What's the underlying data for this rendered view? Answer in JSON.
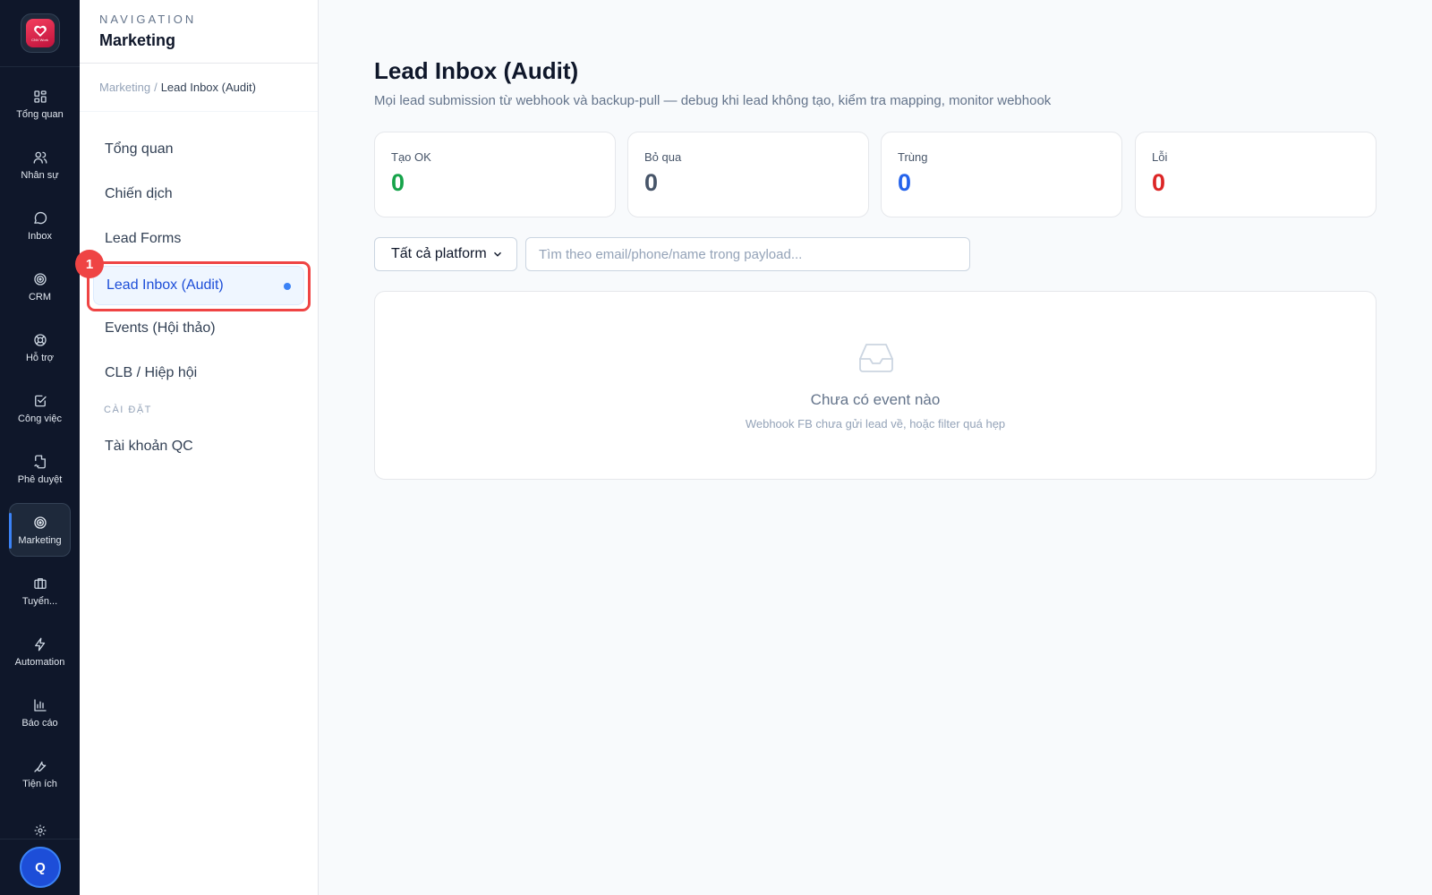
{
  "rail": {
    "logo_text": "CNV Work",
    "items": [
      {
        "label": "Tổng quan",
        "icon": "grid-icon"
      },
      {
        "label": "Nhân sự",
        "icon": "users-icon"
      },
      {
        "label": "Inbox",
        "icon": "chat-bubble-icon"
      },
      {
        "label": "CRM",
        "icon": "target-icon"
      },
      {
        "label": "Hỗ trợ",
        "icon": "lifebuoy-icon"
      },
      {
        "label": "Công việc",
        "icon": "checkbox-icon"
      },
      {
        "label": "Phê duyệt",
        "icon": "document-signature-icon"
      },
      {
        "label": "Marketing",
        "icon": "target-icon"
      },
      {
        "label": "Tuyển...",
        "icon": "briefcase-icon"
      },
      {
        "label": "Automation",
        "icon": "lightning-icon"
      },
      {
        "label": "Báo cáo",
        "icon": "bar-chart-icon"
      },
      {
        "label": "Tiện ích",
        "icon": "wrench-icon"
      }
    ],
    "active_index": 7,
    "settings_icon": "gear-icon",
    "avatar_initial": "Q"
  },
  "subnav": {
    "kicker": "NAVIGATION",
    "title": "Marketing",
    "breadcrumb": {
      "parent": "Marketing",
      "separator": "/",
      "current": "Lead Inbox (Audit)"
    },
    "items": [
      {
        "label": "Tổng quan"
      },
      {
        "label": "Chiến dịch"
      },
      {
        "label": "Lead Forms"
      },
      {
        "label": "Lead Inbox (Audit)"
      },
      {
        "label": "Events (Hội thảo)"
      },
      {
        "label": "CLB / Hiệp hội"
      }
    ],
    "section_label": "CÀI ĐẶT",
    "section_items": [
      {
        "label": "Tài khoản QC"
      }
    ],
    "active_index": 3,
    "step_badge": "1"
  },
  "main": {
    "title": "Lead Inbox (Audit)",
    "subtitle": "Mọi lead submission từ webhook và backup-pull — debug khi lead không tạo, kiểm tra mapping, monitor webhook",
    "stats": [
      {
        "label": "Tạo OK",
        "value": "0",
        "color": "#16a34a"
      },
      {
        "label": "Bỏ qua",
        "value": "0",
        "color": "#475569"
      },
      {
        "label": "Trùng",
        "value": "0",
        "color": "#2563eb"
      },
      {
        "label": "Lỗi",
        "value": "0",
        "color": "#dc2626"
      }
    ],
    "filter": {
      "selected": "Tất cả platform"
    },
    "search": {
      "value": "",
      "placeholder": "Tìm theo email/phone/name trong payload..."
    },
    "empty": {
      "icon": "inbox-tray-icon",
      "title": "Chưa có event nào",
      "description": "Webhook FB chưa gửi lead về, hoặc filter quá hẹp"
    }
  },
  "colors": {
    "rail_bg": "#0f172a",
    "accent": "#3b82f6",
    "highlight": "#ef4444"
  }
}
